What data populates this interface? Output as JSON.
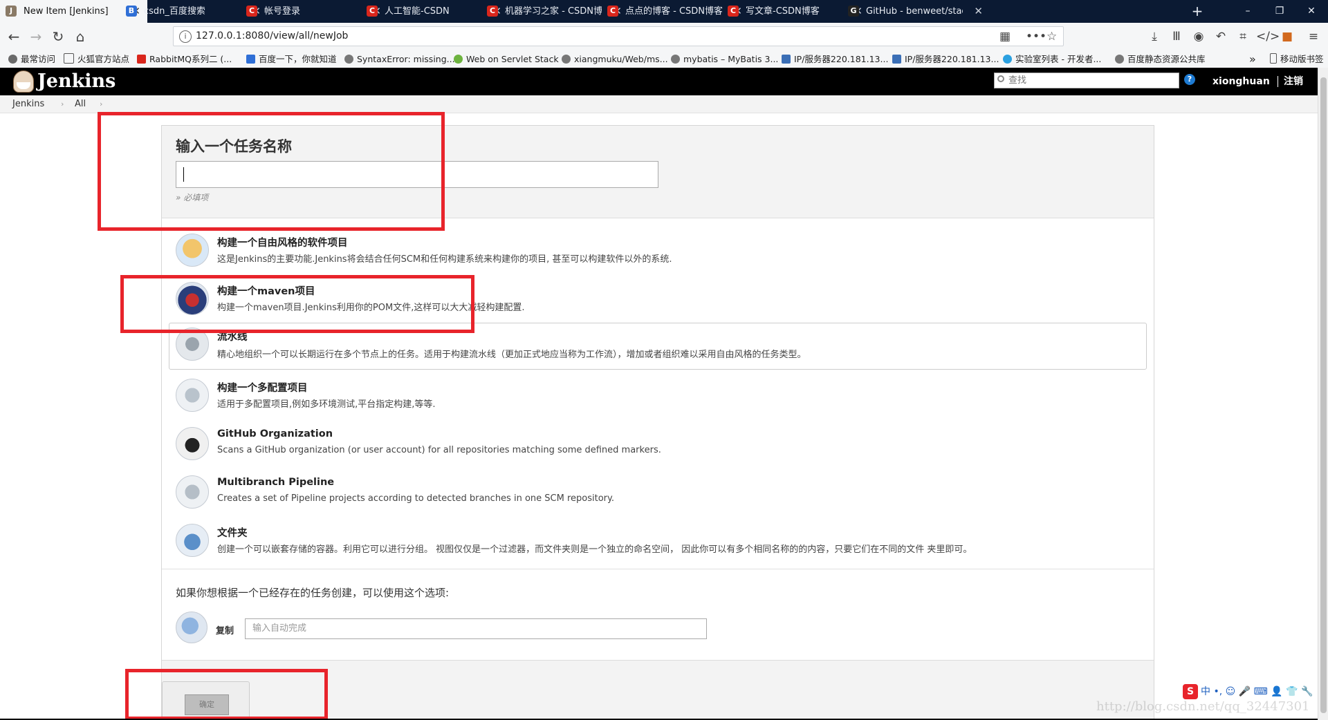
{
  "browser": {
    "tabs": [
      {
        "label": "New Item [Jenkins]",
        "icon": "jenkins-icon",
        "active": true
      },
      {
        "label": "csdn_百度搜索",
        "icon": "baidu-icon",
        "active": false
      },
      {
        "label": "帐号登录",
        "icon": "csdn-icon",
        "active": false
      },
      {
        "label": "人工智能-CSDN",
        "icon": "csdn-icon",
        "active": false
      },
      {
        "label": "机器学习之家 - CSDN博客",
        "icon": "csdn-icon",
        "active": false
      },
      {
        "label": "点点的博客 - CSDN博客",
        "icon": "csdn-icon",
        "active": false
      },
      {
        "label": "写文章-CSDN博客",
        "icon": "csdn-icon",
        "active": false
      },
      {
        "label": "GitHub - benweet/stacked",
        "icon": "github-icon",
        "active": false
      }
    ],
    "new_tab": "+",
    "window_controls": {
      "minimize": "–",
      "restore": "❐",
      "close": "✕"
    },
    "url": "127.0.0.1:8080/view/all/newJob",
    "bookmarks": [
      {
        "label": "最常访问"
      },
      {
        "label": "火狐官方站点"
      },
      {
        "label": "RabbitMQ系列二 (..."
      },
      {
        "label": "百度一下，你就知道"
      },
      {
        "label": "SyntaxError: missing..."
      },
      {
        "label": "Web on Servlet Stack"
      },
      {
        "label": "xiangmuku/Web/ms..."
      },
      {
        "label": "mybatis – MyBatis 3..."
      },
      {
        "label": "IP/服务器220.181.13..."
      },
      {
        "label": "IP/服务器220.181.13..."
      },
      {
        "label": "实验室列表 - 开发者..."
      },
      {
        "label": "百度静态资源公共库"
      }
    ],
    "bookmarks_overflow": "»",
    "mobile_bookmarks": "移动版书签"
  },
  "jenkins": {
    "title": "Jenkins",
    "search_placeholder": "查找",
    "help": "?",
    "user": "xionghuan",
    "logout": "注销",
    "breadcrumbs": [
      "Jenkins",
      "All"
    ]
  },
  "form": {
    "name_title": "输入一个任务名称",
    "required_hint": "» 必填项",
    "items": [
      {
        "title": "构建一个自由风格的软件项目",
        "desc": "这是Jenkins的主要功能.Jenkins将会结合任何SCM和任何构建系统来构建你的项目, 甚至可以构建软件以外的系统."
      },
      {
        "title": "构建一个maven项目",
        "desc": "构建一个maven项目.Jenkins利用你的POM文件,这样可以大大减轻构建配置."
      },
      {
        "title": "流水线",
        "desc": "精心地组织一个可以长期运行在多个节点上的任务。适用于构建流水线（更加正式地应当称为工作流），增加或者组织难以采用自由风格的任务类型。"
      },
      {
        "title": "构建一个多配置项目",
        "desc": "适用于多配置项目,例如多环境测试,平台指定构建,等等."
      },
      {
        "title": "GitHub Organization",
        "desc": "Scans a GitHub organization (or user account) for all repositories matching some defined markers."
      },
      {
        "title": "Multibranch Pipeline",
        "desc": "Creates a set of Pipeline projects according to detected branches in one SCM repository."
      },
      {
        "title": "文件夹",
        "desc": "创建一个可以嵌套存储的容器。利用它可以进行分组。 视图仅仅是一个过滤器，而文件夹则是一个独立的命名空间， 因此你可以有多个相同名称的的内容，只要它们在不同的文件 夹里即可。"
      }
    ],
    "copy_prompt": "如果你想根据一个已经存在的任务创建，可以使用这个选项:",
    "copy_label": "复制",
    "copy_placeholder": "输入自动完成",
    "ok_label": "确定"
  },
  "ime": {
    "logo": "S",
    "text": "中 •, ☺ 🎤 ⌨ 👤 👕 🔧"
  },
  "watermark": "http://blog.csdn.net/qq_32447301",
  "colors": {
    "annotation_red": "#e8242b",
    "header_black": "#000000",
    "tab_strip": "#0b1a33"
  }
}
